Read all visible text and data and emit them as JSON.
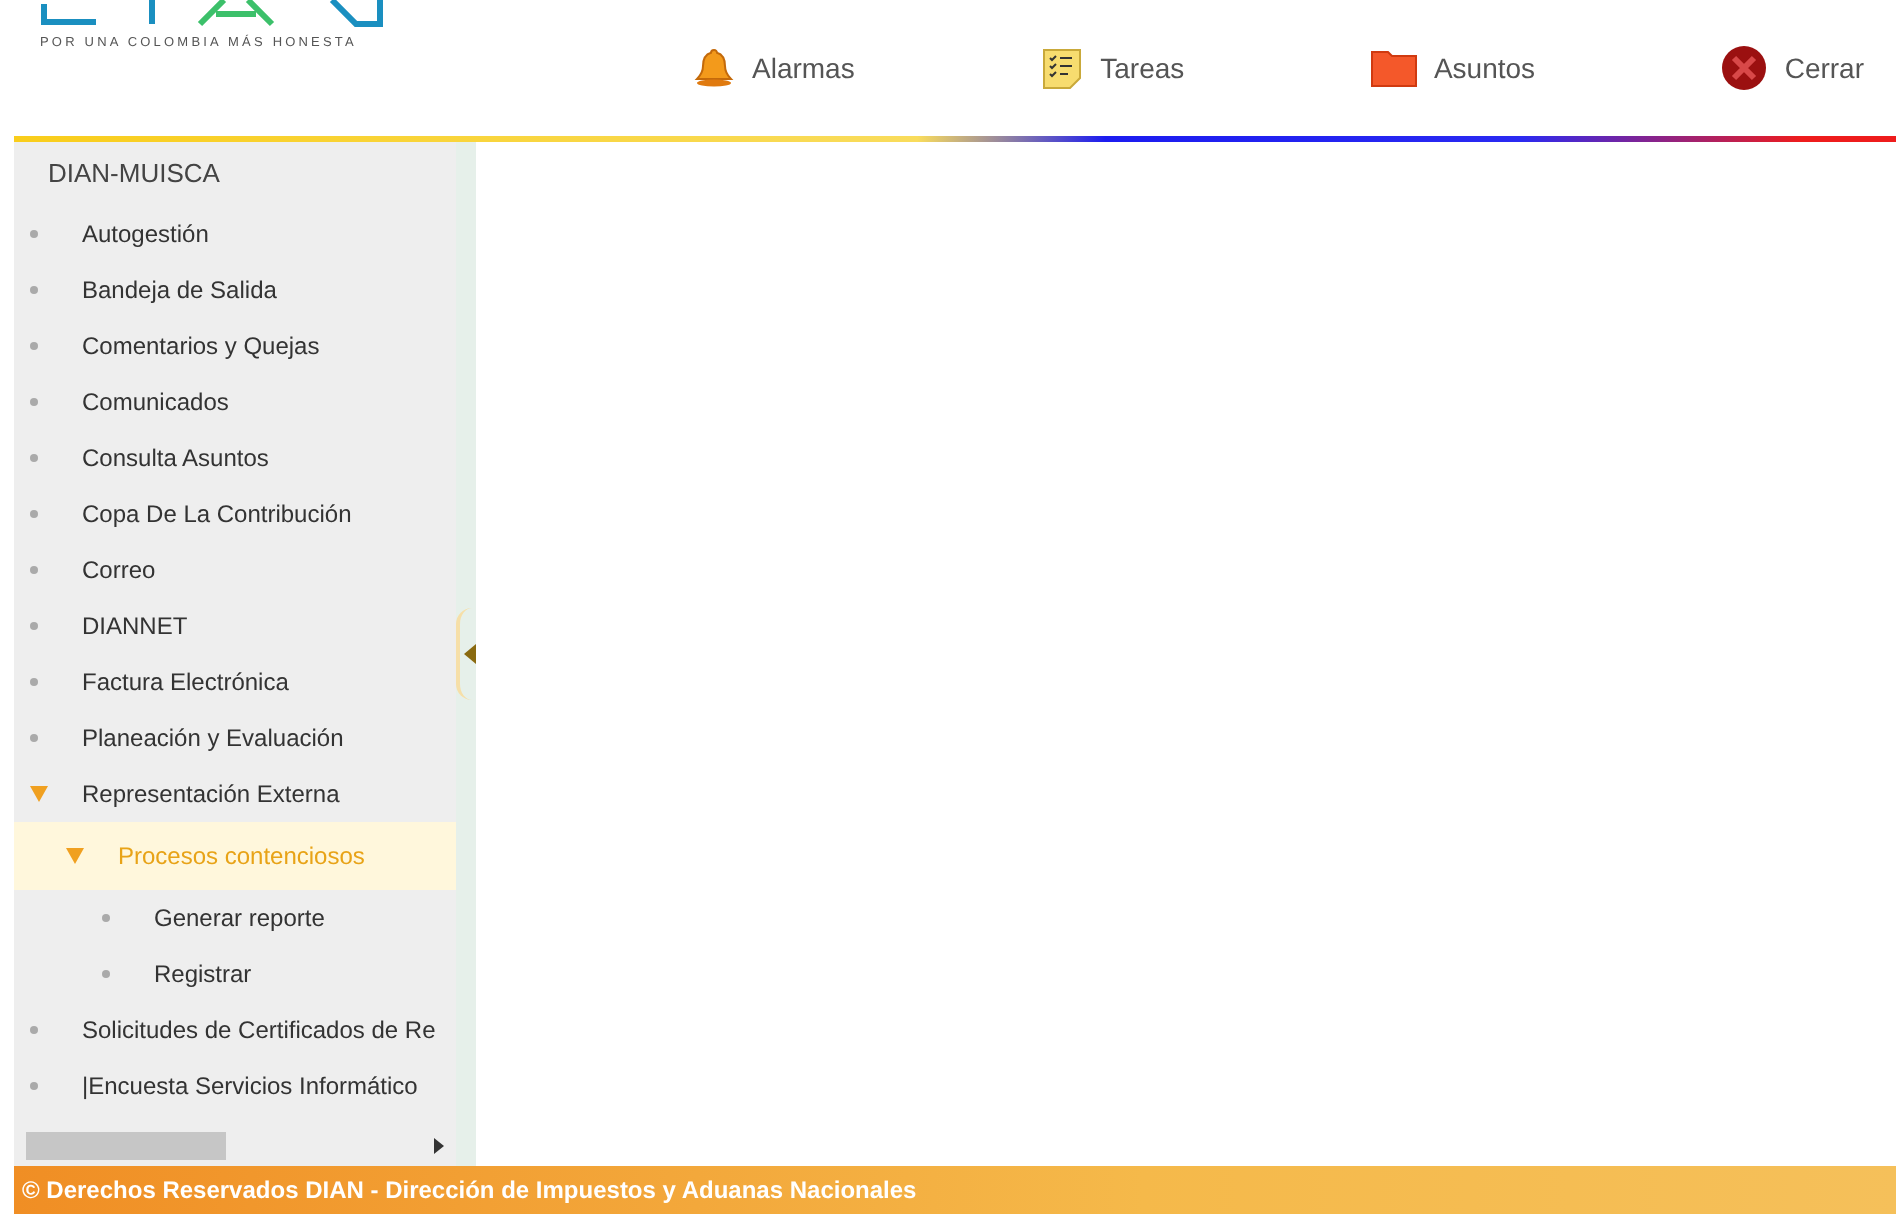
{
  "header": {
    "tagline": "POR UNA COLOMBIA MÁS HONESTA",
    "actions": [
      {
        "kind": "bell",
        "label": "Alarmas"
      },
      {
        "kind": "notes",
        "label": "Tareas"
      },
      {
        "kind": "folder",
        "label": "Asuntos"
      },
      {
        "kind": "close",
        "label": "Cerrar"
      }
    ]
  },
  "sidebar": {
    "title": "DIAN-MUISCA",
    "items": [
      {
        "label": "Autogestión",
        "expanded": false,
        "selected": false
      },
      {
        "label": "Bandeja de Salida",
        "expanded": false,
        "selected": false
      },
      {
        "label": "Comentarios y Quejas",
        "expanded": false,
        "selected": false
      },
      {
        "label": "Comunicados",
        "expanded": false,
        "selected": false
      },
      {
        "label": "Consulta Asuntos",
        "expanded": false,
        "selected": false
      },
      {
        "label": "Copa De La Contribución",
        "expanded": false,
        "selected": false
      },
      {
        "label": "Correo",
        "expanded": false,
        "selected": false
      },
      {
        "label": "DIANNET",
        "expanded": false,
        "selected": false
      },
      {
        "label": "Factura Electrónica",
        "expanded": false,
        "selected": false
      },
      {
        "label": "Planeación y Evaluación",
        "expanded": false,
        "selected": false
      },
      {
        "label": "Representación Externa",
        "expanded": true,
        "selected": false,
        "children": [
          {
            "label": "Procesos contenciosos",
            "expanded": true,
            "selected": true,
            "children": [
              {
                "label": "Generar reporte",
                "expanded": false,
                "selected": false
              },
              {
                "label": "Registrar",
                "expanded": false,
                "selected": false
              }
            ]
          }
        ]
      },
      {
        "label": "Solicitudes de Certificados de Re",
        "expanded": false,
        "selected": false
      },
      {
        "label": "|Encuesta Servicios Informático",
        "expanded": false,
        "selected": false
      }
    ]
  },
  "footer": {
    "text": "© Derechos Reservados DIAN - Dirección de Impuestos y Aduanas Nacionales"
  }
}
